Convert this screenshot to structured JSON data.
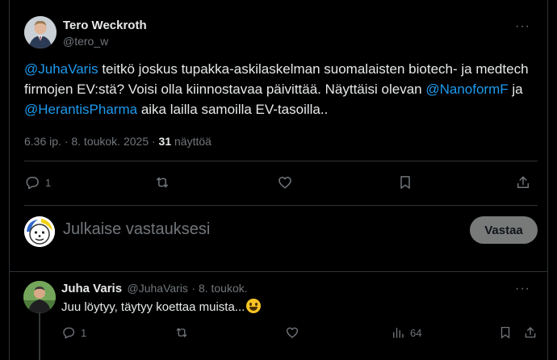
{
  "main_tweet": {
    "author_name": "Tero Weckroth",
    "author_handle": "@tero_w",
    "more_label": "···",
    "text": {
      "m1": "@JuhaVaris",
      "t1": " teitkö joskus tupakka-askilaskelman suomalaisten biotech- ja medtech firmojen EV:stä? Voisi olla kiinnostavaa päivittää. Näyttäisi olevan ",
      "m2": "@NanoformF",
      "t2": " ja ",
      "m3": "@HerantisPharma",
      "t3": " aika lailla samoilla EV-tasoilla.."
    },
    "timestamp": "6.36 ip. · 8. toukok. 2025 ·",
    "views_count": "31",
    "views_label": "näyttöä",
    "actions": {
      "reply_count": "1",
      "retweet_icon": "retweet-icon",
      "like_icon": "heart-icon",
      "bookmark_icon": "bookmark-icon",
      "share_icon": "share-icon"
    }
  },
  "reply_composer": {
    "placeholder": "Julkaise vastauksesi",
    "button_label": "Vastaa"
  },
  "reply_tweet": {
    "author_name": "Juha Varis",
    "author_handle": "@JuhaVaris",
    "date": "· 8. toukok.",
    "more_label": "···",
    "text": "Juu löytyy, täytyy koettaa muista...",
    "reply_count": "1",
    "views_count": "64"
  },
  "colors": {
    "background": "#000000",
    "text": "#e7e9ea",
    "muted": "#71767b",
    "link": "#1d9bf0",
    "border": "#2f3336",
    "button_bg": "#787a7a"
  }
}
